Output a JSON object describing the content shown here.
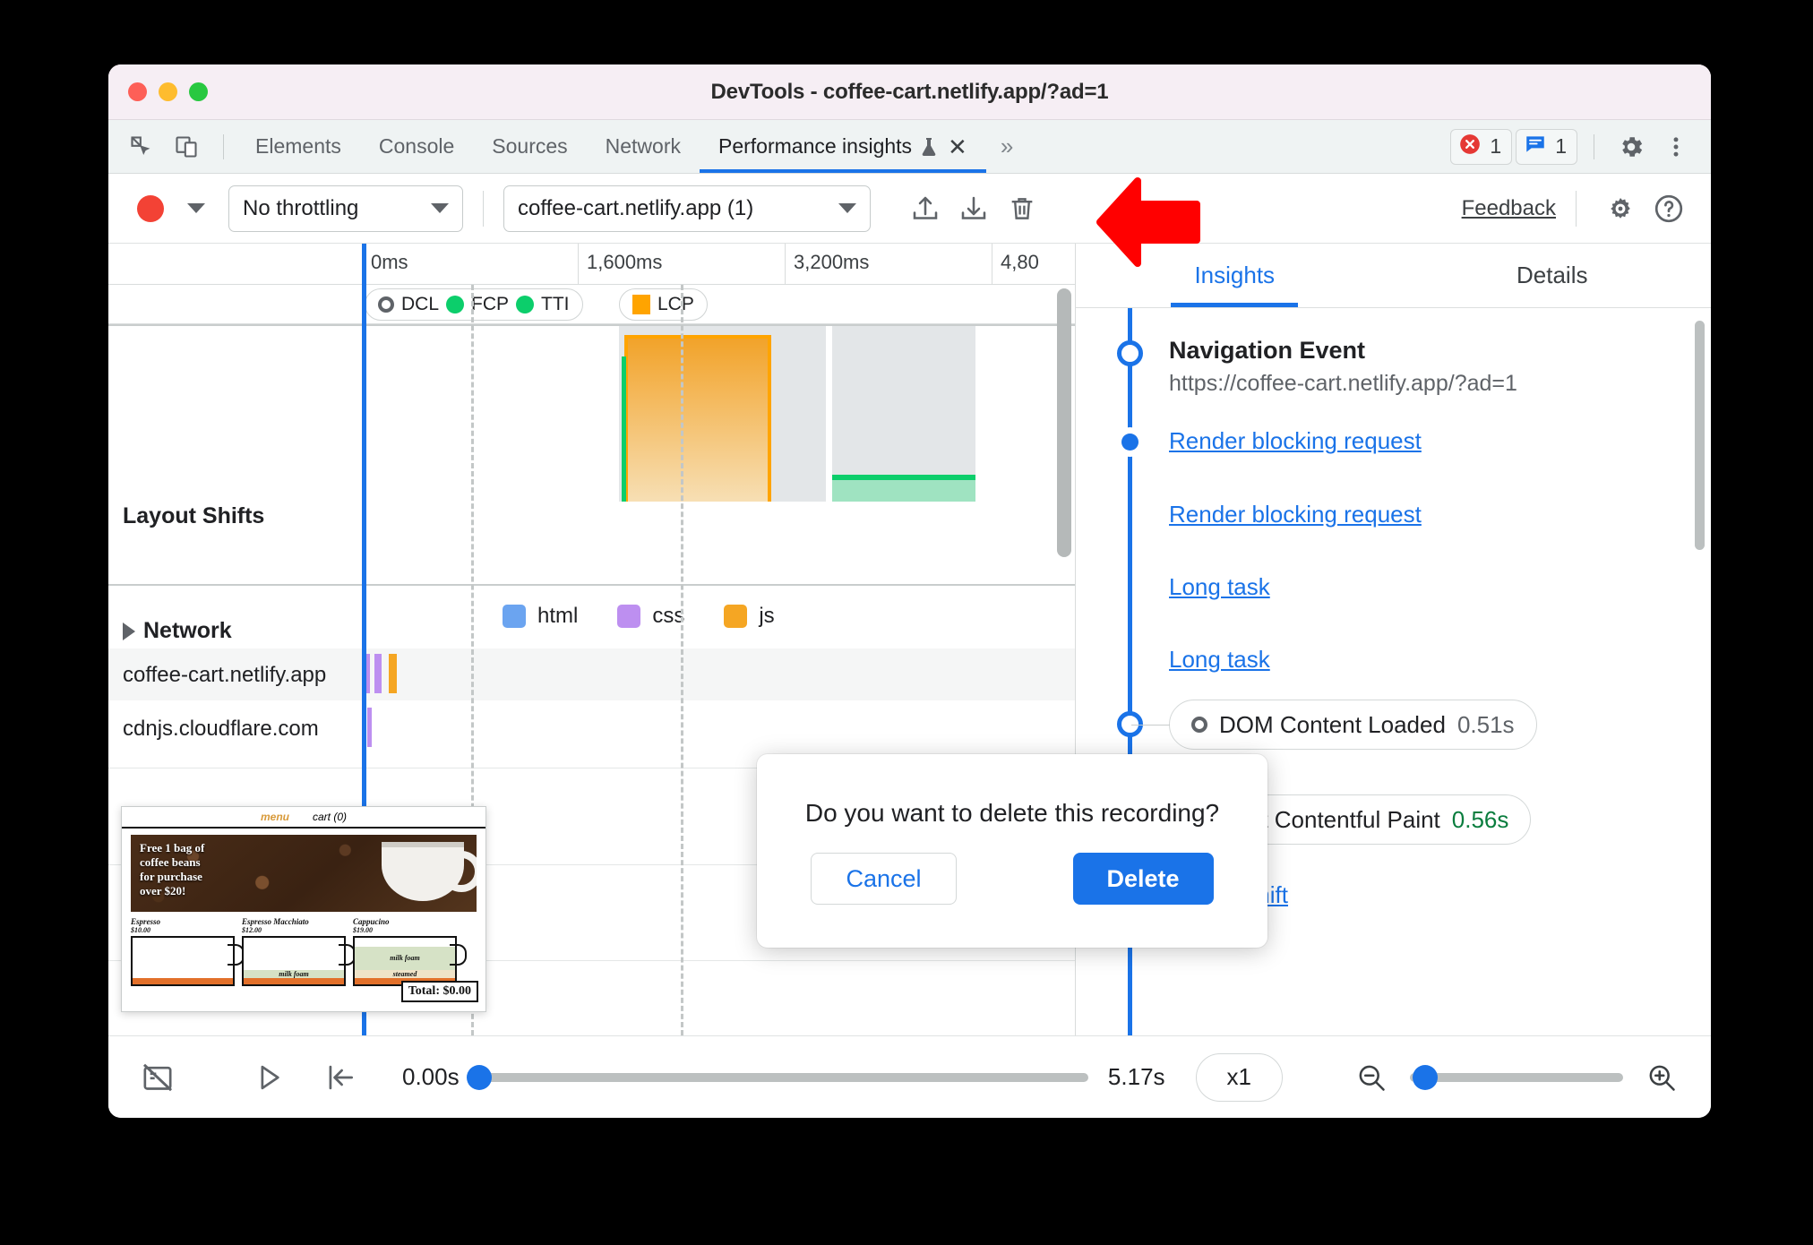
{
  "window": {
    "title": "DevTools - coffee-cart.netlify.app/?ad=1",
    "traffic_lights": [
      "close",
      "minimize",
      "maximize"
    ]
  },
  "tabstrip": {
    "left_icons": [
      "inspect-element-icon",
      "device-toolbar-icon"
    ],
    "tabs": [
      {
        "label": "Elements",
        "active": false
      },
      {
        "label": "Console",
        "active": false
      },
      {
        "label": "Sources",
        "active": false
      },
      {
        "label": "Network",
        "active": false
      },
      {
        "label": "Performance insights",
        "active": true,
        "experimental": true,
        "closable": true
      }
    ],
    "overflow_label": "»",
    "close_label": "✕",
    "badges": [
      {
        "name": "error-badge",
        "icon": "error-icon",
        "count": "1",
        "color": "#e53935"
      },
      {
        "name": "message-badge",
        "icon": "message-icon",
        "count": "1",
        "color": "#1a73e8"
      }
    ],
    "settings_icon": "gear-icon",
    "more_icon": "kebab-menu-icon"
  },
  "perf_toolbar": {
    "record_label": "record-button",
    "throttling": {
      "value": "No throttling",
      "name": "throttling-select"
    },
    "page_select": {
      "value": "coffee-cart.netlify.app (1)",
      "name": "page-select"
    },
    "actions": [
      {
        "name": "upload-profile-button",
        "icon": "upload-icon"
      },
      {
        "name": "download-profile-button",
        "icon": "download-icon"
      },
      {
        "name": "delete-recording-button",
        "icon": "trash-icon"
      }
    ],
    "feedback_label": "Feedback",
    "settings_icon": "capture-settings-icon",
    "help_icon": "help-icon"
  },
  "timeline": {
    "ruler_ticks": [
      "0ms",
      "1,600ms",
      "3,200ms",
      "4,80"
    ],
    "markers": [
      {
        "label": "DCL",
        "glyph": "ring",
        "color": "#5f6368"
      },
      {
        "label": "FCP",
        "glyph": "dot",
        "color": "#0cce6b"
      },
      {
        "label": "TTI",
        "glyph": "dot",
        "color": "#0cce6b"
      },
      {
        "label": "LCP",
        "glyph": "square",
        "color": "#ffa400"
      }
    ],
    "tracks": [
      {
        "name": "layout-shifts-track",
        "label": "Layout Shifts",
        "expandable": false
      },
      {
        "name": "network-track",
        "label": "Network",
        "expandable": true
      }
    ],
    "network_legend": [
      {
        "label": "html",
        "color": "#6ba4f0"
      },
      {
        "label": "css",
        "color": "#bd8ff0"
      },
      {
        "label": "js",
        "color": "#f5a623"
      }
    ],
    "requests": [
      {
        "host": "coffee-cart.netlify.app",
        "selected": true
      },
      {
        "host": "cdnjs.cloudflare.com",
        "selected": false
      }
    ]
  },
  "screenshot_preview": {
    "nav": {
      "menu": "menu",
      "cart": "cart (0)"
    },
    "hero_text": "Free 1 bag of\ncoffee beans\nfor purchase\nover $20!",
    "products": [
      {
        "name": "Espresso",
        "price": "$10.00",
        "foam": "",
        "steamed": ""
      },
      {
        "name": "Espresso Macchiato",
        "price": "$12.00",
        "foam": "milk foam",
        "steamed": ""
      },
      {
        "name": "Cappucino",
        "price": "$19.00",
        "foam": "milk foam",
        "steamed": "steamed"
      }
    ],
    "total": "Total: $0.00"
  },
  "sidebar": {
    "tabs": [
      {
        "label": "Insights",
        "active": true
      },
      {
        "label": "Details",
        "active": false
      }
    ],
    "items": [
      {
        "type": "heading",
        "title": "Navigation Event",
        "subtitle": "https://coffee-cart.netlify.app/?ad=1",
        "node": "large"
      },
      {
        "type": "link",
        "label": "Render blocking request",
        "node": "small"
      },
      {
        "type": "link",
        "label": "Render blocking request",
        "node": "none"
      },
      {
        "type": "link",
        "label": "Long task",
        "node": "none"
      },
      {
        "type": "link",
        "label": "Long task",
        "node": "none"
      },
      {
        "type": "pill",
        "label": "DOM Content Loaded",
        "value": "0.51s",
        "glyph": "ring",
        "value_color": "#5f6368",
        "node": "large"
      },
      {
        "type": "pill",
        "label": "First Contentful Paint",
        "value": "0.56s",
        "glyph": "dot",
        "value_color": "#0a7d3e",
        "node": "large"
      },
      {
        "type": "link",
        "label": "Layout shift",
        "node": "small"
      }
    ]
  },
  "bottom_toolbar": {
    "screenshots_icon": "screenshots-off-icon",
    "play_icon": "play-icon",
    "rewind_icon": "jump-to-start-icon",
    "current_time": "0.00s",
    "total_time": "5.17s",
    "speed": "x1",
    "zoom_out_icon": "zoom-out-icon",
    "zoom_in_icon": "zoom-in-icon"
  },
  "dialog": {
    "message": "Do you want to delete this recording?",
    "cancel_label": "Cancel",
    "confirm_label": "Delete"
  },
  "annotation": {
    "arrow_color": "#ff0000",
    "points_to": "delete-recording-button"
  }
}
